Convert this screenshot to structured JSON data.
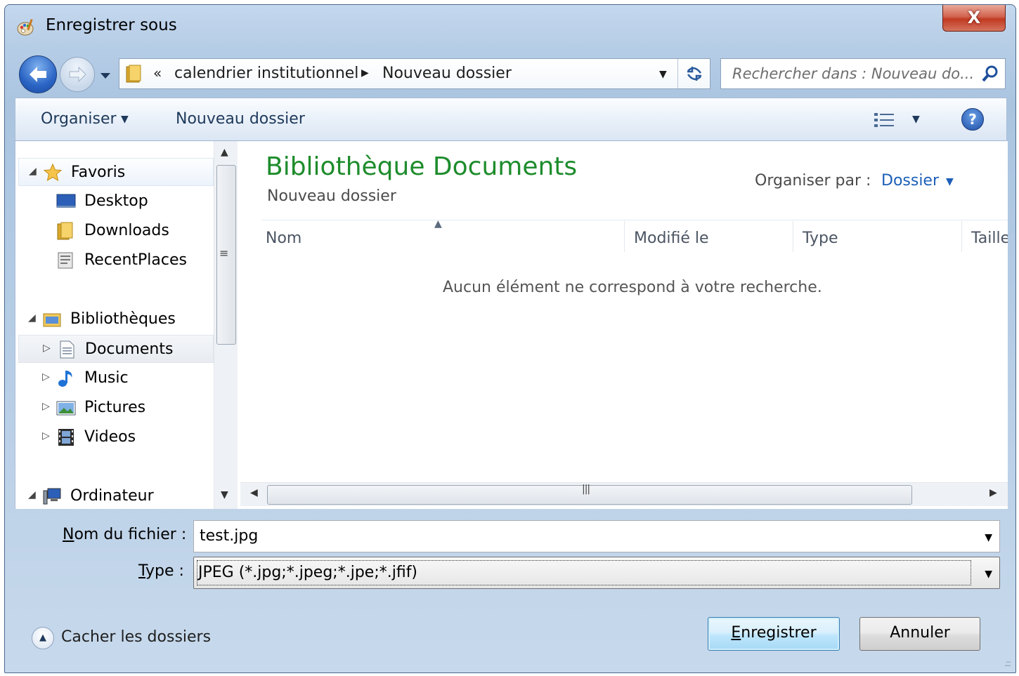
{
  "window": {
    "title": "Enregistrer sous",
    "close_label": "X"
  },
  "address_bar": {
    "overflow_chevron": "«",
    "crumbs": [
      "calendrier institutionnel",
      "Nouveau dossier"
    ]
  },
  "search": {
    "placeholder": "Rechercher dans : Nouveau do..."
  },
  "toolbar": {
    "organize_label": "Organiser",
    "new_folder_label": "Nouveau dossier",
    "help_label": "?"
  },
  "nav_tree": {
    "favorites": {
      "label": "Favoris",
      "items": [
        "Desktop",
        "Downloads",
        "RecentPlaces"
      ]
    },
    "libraries": {
      "label": "Bibliothèques",
      "items": [
        "Documents",
        "Music",
        "Pictures",
        "Videos"
      ]
    },
    "computer": {
      "label": "Ordinateur"
    },
    "selected": "Documents"
  },
  "content": {
    "library_title": "Bibliothèque Documents",
    "library_subtitle": "Nouveau dossier",
    "arrange_by_label": "Organiser par :",
    "arrange_by_value": "Dossier",
    "columns": [
      "Nom",
      "Modifié le",
      "Type",
      "Taille"
    ],
    "empty_message": "Aucun élément ne correspond à votre recherche."
  },
  "form": {
    "filename_label_accel": "N",
    "filename_label_rest": "om du fichier :",
    "filename_value": "test.jpg",
    "type_label_accel": "T",
    "type_label_rest": "ype :",
    "type_value": "JPEG (*.jpg;*.jpeg;*.jpe;*.jfif)"
  },
  "footer": {
    "hide_folders_label": "Cacher les dossiers",
    "save_accel": "E",
    "save_rest": "nregistrer",
    "cancel_label": "Annuler"
  },
  "colors": {
    "library_title": "#1e8c2c",
    "link_blue": "#1c5fb8"
  }
}
